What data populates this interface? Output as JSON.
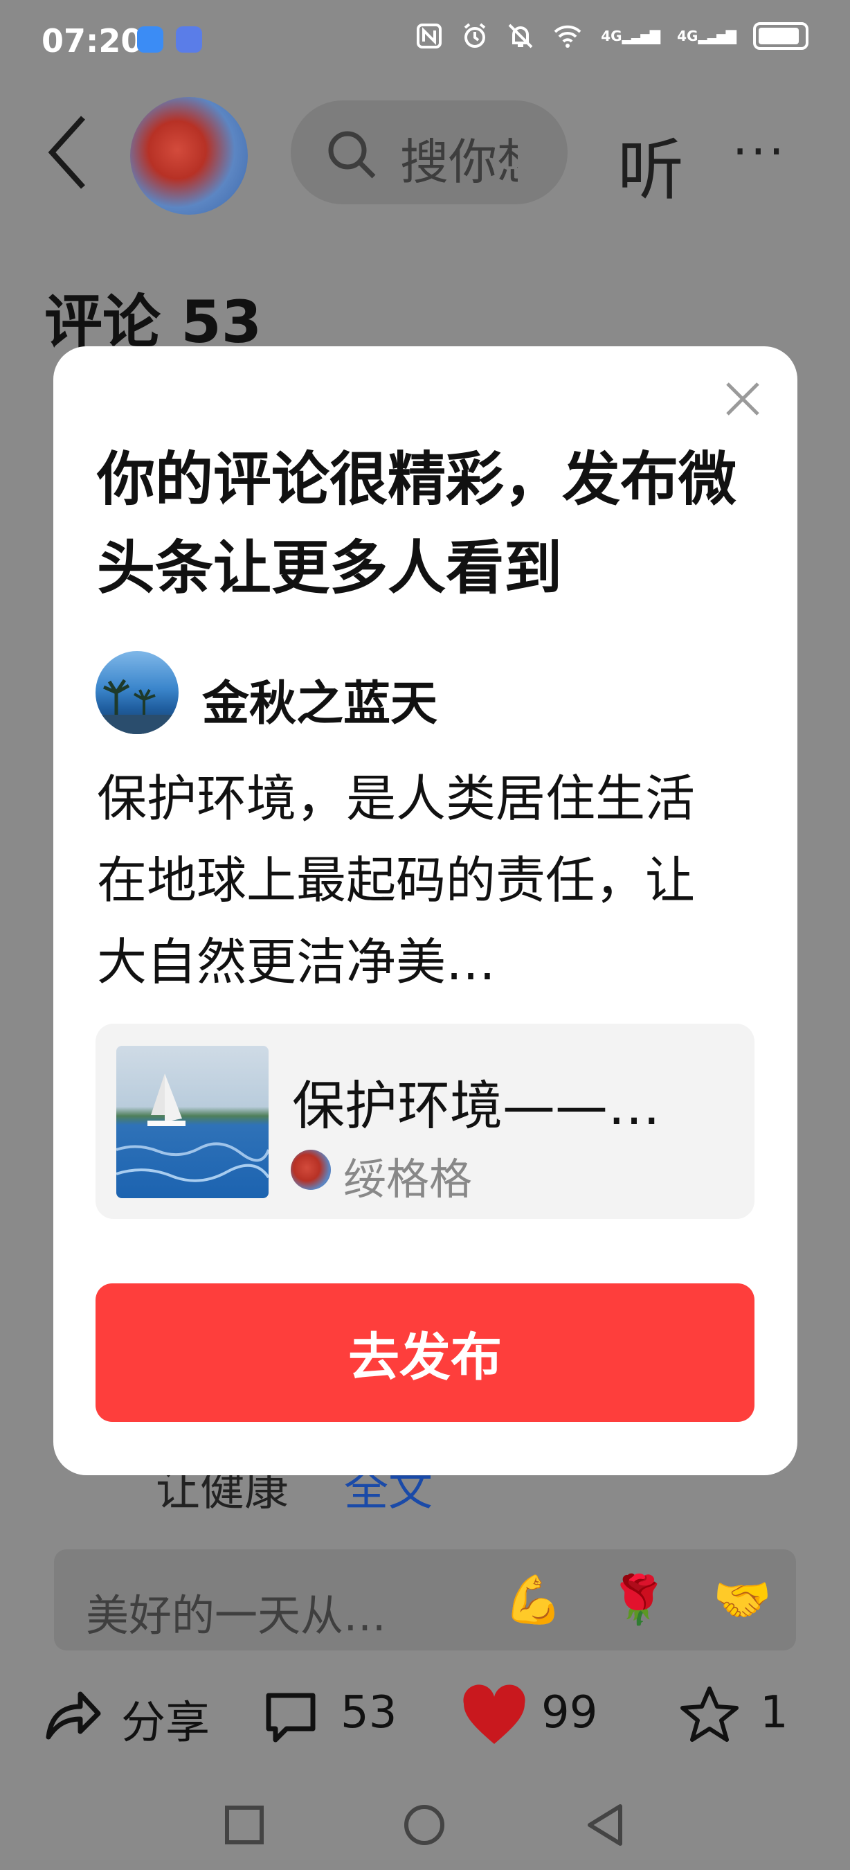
{
  "status_bar": {
    "time": "07:20",
    "icons": [
      "chat-bubble-icon",
      "app-notification-icon",
      "nfc-icon",
      "alarm-icon",
      "mute-icon",
      "wifi-icon",
      "signal-4g-icon",
      "signal-4g-icon",
      "battery-icon"
    ],
    "network_1": "4G",
    "network_2": "4G"
  },
  "header": {
    "search_placeholder": "搜你想",
    "listen_label": "听",
    "more_label": "···"
  },
  "comments": {
    "title": "评论 53",
    "background_snippet": "让健康",
    "background_link": "全文"
  },
  "modal": {
    "title": "你的评论很精彩，发布微头条让更多人看到",
    "author_name": "金秋之蓝天",
    "comment_text": "保护环境，是人类居住生活在地球上最起码的责任，让大自然更洁净美…",
    "quote_title": "保护环境——…",
    "quote_author": "绥格格",
    "publish_label": "去发布"
  },
  "input_bar": {
    "placeholder": "美好的一天从…",
    "emojis": [
      "💪",
      "🌹",
      "🤝"
    ]
  },
  "actions": {
    "share_label": "分享",
    "comment_count": "53",
    "like_count": "99",
    "favorite_count": "1"
  },
  "colors": {
    "overlay": "#8a8a8a",
    "accent_red": "#fe3e3c",
    "heart_red": "#c9181e"
  }
}
